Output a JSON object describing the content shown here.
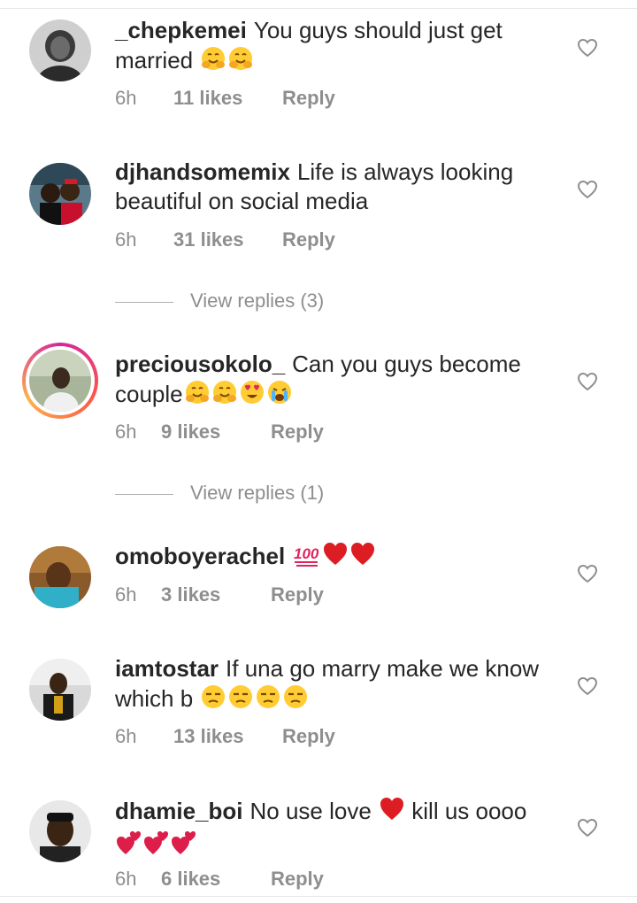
{
  "comments": [
    {
      "username": "_chepkemei",
      "text": "You guys should just get married",
      "emojis": [
        "hugging-face",
        "hugging-face"
      ],
      "time": "6h",
      "likes": "11 likes",
      "reply": "Reply"
    },
    {
      "username": "djhandsomemix",
      "text": "Life is always looking beautiful on social media",
      "emojis": [],
      "time": "6h",
      "likes": "31 likes",
      "reply": "Reply"
    },
    {
      "username": "preciousokolo_",
      "text": "Can you guys become couple",
      "emojis": [
        "hugging-face",
        "hugging-face",
        "heart-eyes",
        "crying-face"
      ],
      "time": "6h",
      "likes": "9 likes",
      "reply": "Reply",
      "has_story": true
    },
    {
      "username": "omoboyerachel",
      "text": "",
      "emojis": [
        "hundred-points",
        "red-heart",
        "red-heart"
      ],
      "time": "6h",
      "likes": "3 likes",
      "reply": "Reply"
    },
    {
      "username": "iamtostar",
      "text": "If una go marry make we know which b",
      "emojis": [
        "unamused-face",
        "unamused-face",
        "unamused-face",
        "unamused-face"
      ],
      "time": "6h",
      "likes": "13 likes",
      "reply": "Reply"
    },
    {
      "username": "dhamie_boi",
      "text_before": "No use love",
      "text_after": "kill us oooo",
      "emojis": [
        "red-heart",
        "two-hearts",
        "two-hearts",
        "two-hearts"
      ],
      "time": "6h",
      "likes": "6 likes",
      "reply": "Reply"
    }
  ],
  "view_replies": [
    {
      "label": "View replies (3)"
    },
    {
      "label": "View replies (1)"
    }
  ],
  "icons": {
    "like": "heart-outline-icon"
  },
  "colors": {
    "text": "#262626",
    "meta": "#8e8e8e",
    "heart_icon": "#8e8e8e"
  }
}
